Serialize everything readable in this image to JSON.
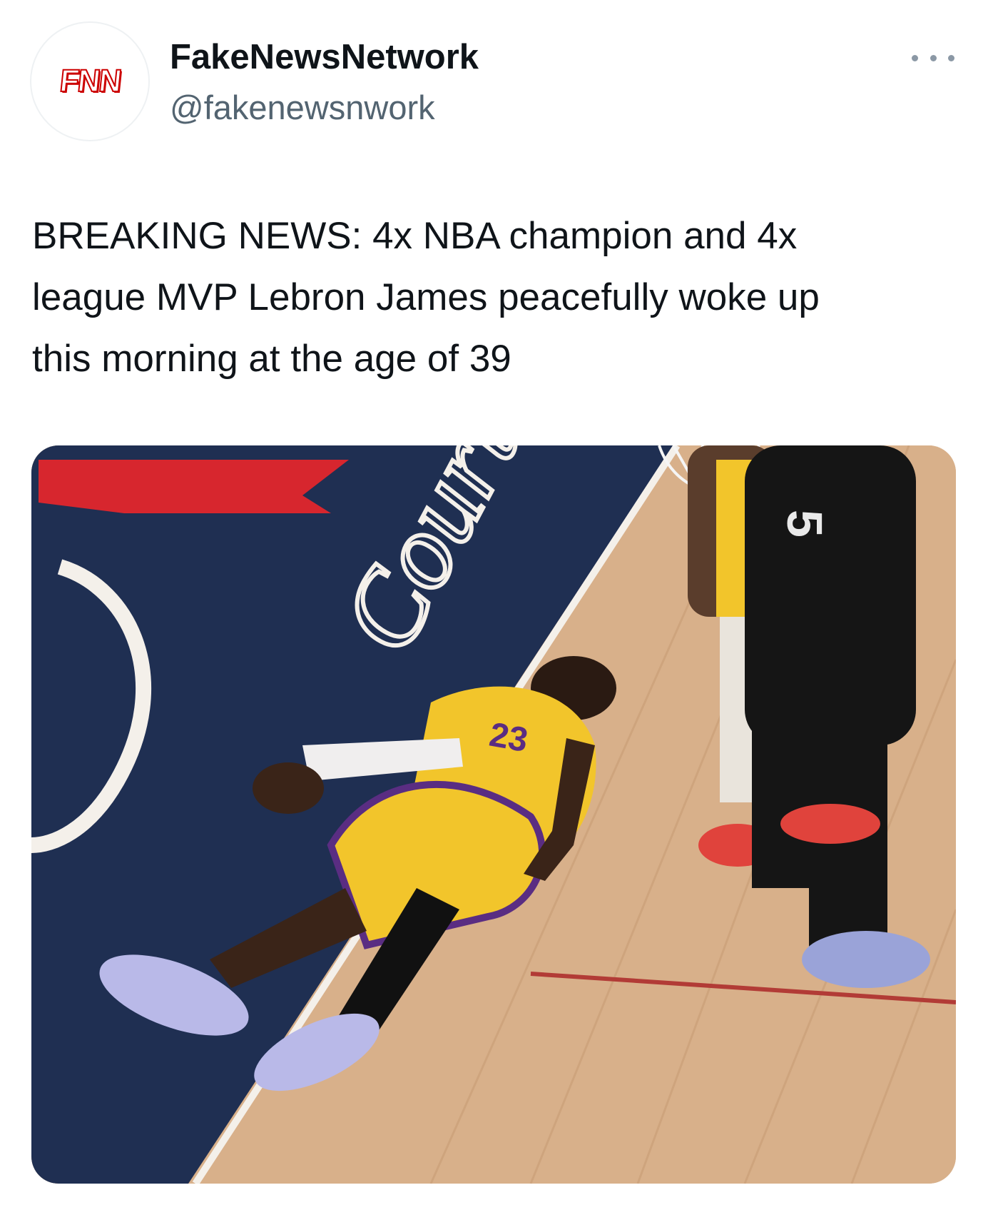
{
  "account": {
    "avatar_text": "FNN",
    "display_name": "FakeNewsNetwork",
    "handle": "@fakenewsnwork"
  },
  "menu": {
    "icon": "more-horizontal-icon"
  },
  "tweet": {
    "lines": [
      "BREAKING NEWS: 4x NBA champion and 4x",
      "league MVP Lebron James peacefully woke up",
      "this morning at the age of 39"
    ]
  },
  "media": {
    "court_text": "Court",
    "jersey_number": "23",
    "opponent_number": "5",
    "colors": {
      "court_blue": "#1f2f52",
      "floor": "#d9b38d",
      "jersey_yellow": "#f2c52b",
      "brand_red": "#cc0000"
    }
  }
}
